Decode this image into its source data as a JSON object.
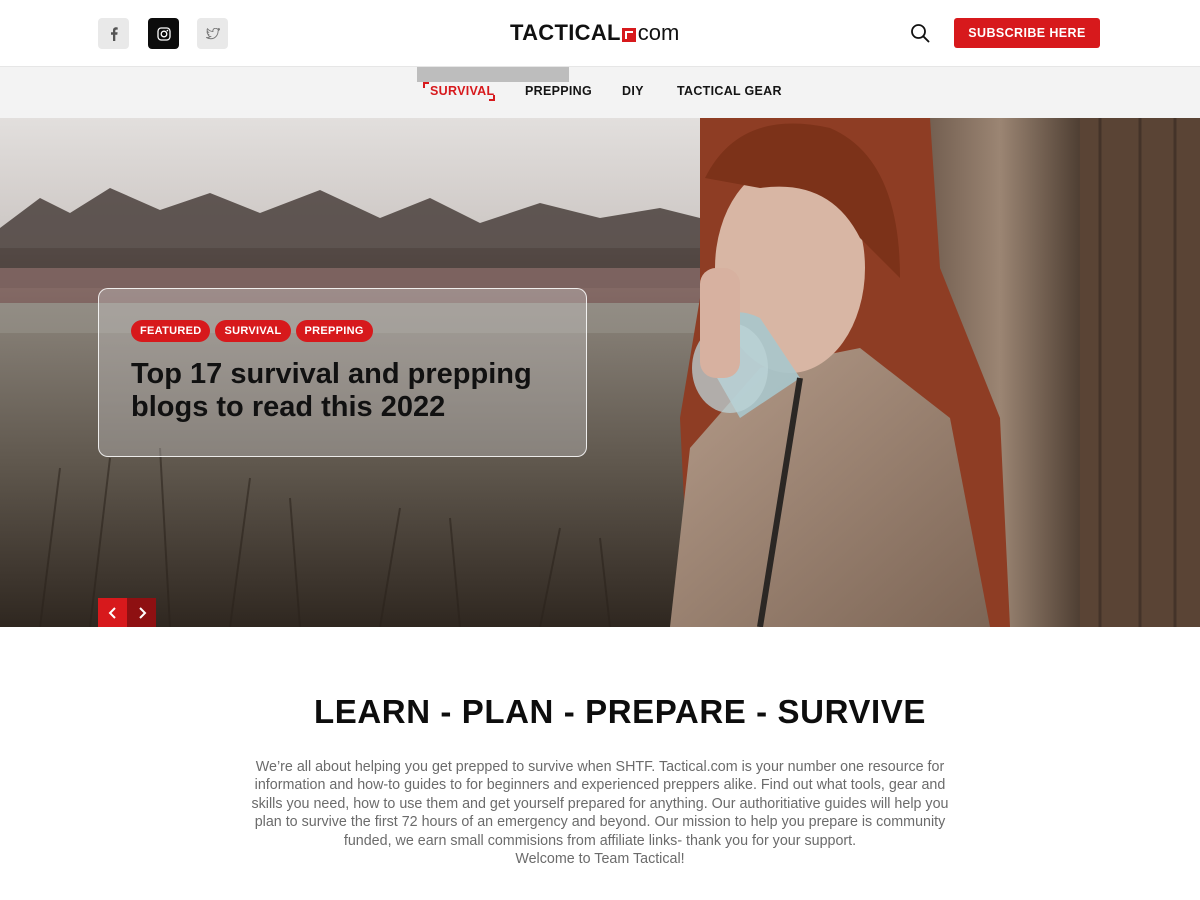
{
  "brand": {
    "logo_text": "TACTICAL",
    "logo_domain": "com",
    "accent_color": "#d7191c"
  },
  "header": {
    "social": [
      {
        "name": "facebook",
        "icon": "facebook-icon"
      },
      {
        "name": "instagram",
        "icon": "instagram-icon"
      },
      {
        "name": "twitter",
        "icon": "twitter-icon"
      }
    ],
    "search_icon": "search-icon",
    "subscribe_label": "SUBSCRIBE HERE"
  },
  "nav": {
    "items": [
      {
        "label": "SURVIVAL",
        "active": true
      },
      {
        "label": "PREPPING",
        "active": false
      },
      {
        "label": "DIY",
        "active": false
      },
      {
        "label": "TACTICAL GEAR",
        "active": false
      }
    ]
  },
  "hero": {
    "tags": [
      "FEATURED",
      "SURVIVAL",
      "PREPPING"
    ],
    "title": "Top 17 survival and prepping blogs to read this 2022",
    "prev_icon": "chevron-left-icon",
    "next_icon": "chevron-right-icon"
  },
  "mission": {
    "title": "LEARN - PLAN - PREPARE - SURVIVE",
    "lines": [
      "We’re all about helping you get prepped to survive when SHTF. Tactical.com is your number one resource for",
      "information and how-to guides to for beginners and experienced preppers alike. Find out what tools, gear and",
      "skills you need, how to use them and get yourself prepared for anything. Our authoritiative guides will help you",
      "plan to survive the first 72 hours of an emergency and beyond. Our mission to help you prepare is community",
      "funded, we earn small commisions from affiliate links- thank you for your support.",
      "Welcome to Team Tactical!"
    ]
  }
}
